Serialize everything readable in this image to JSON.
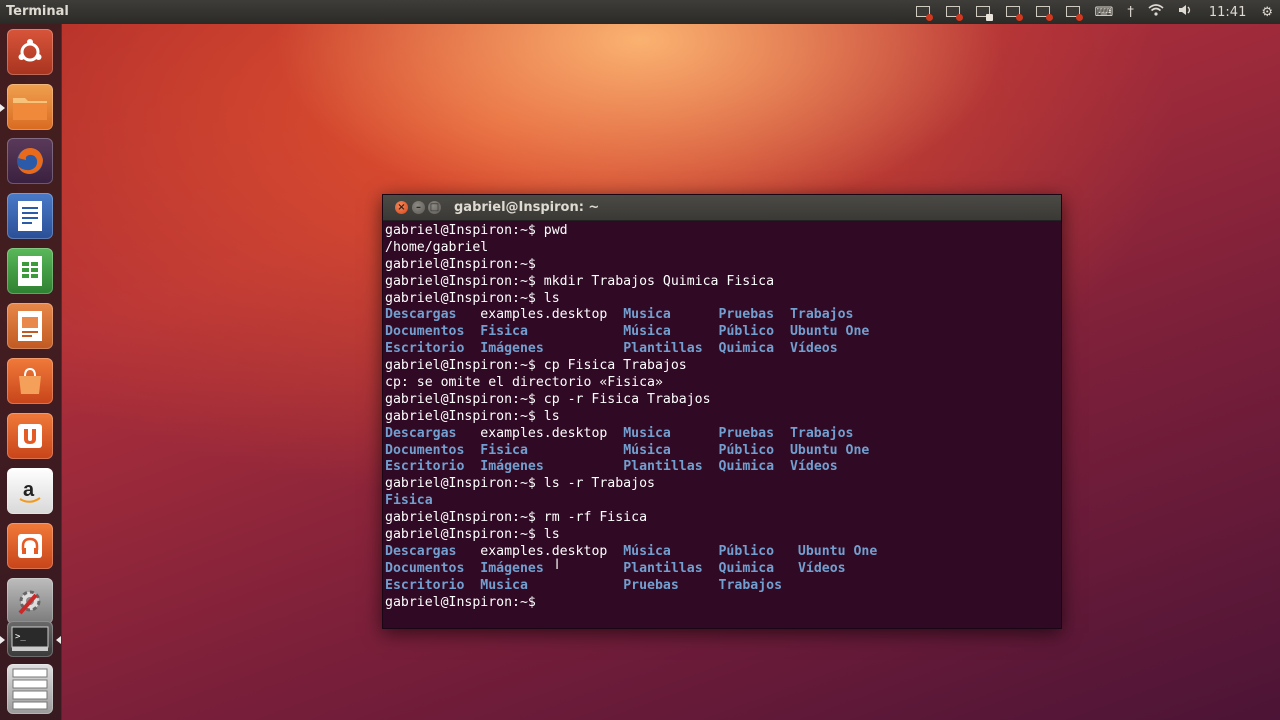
{
  "panel": {
    "app_title": "Terminal",
    "clock": "11:41",
    "indicators": [
      "bluetooth-icon",
      "wifi-icon",
      "volume-icon",
      "settings-gear-icon"
    ]
  },
  "launcher": {
    "items": [
      {
        "name": "ubuntu-dash",
        "color": "#c14a24"
      },
      {
        "name": "files",
        "color": "#e8853a"
      },
      {
        "name": "firefox",
        "color": "#e26a1f"
      },
      {
        "name": "libreoffice-writer",
        "color": "#2f6ab4"
      },
      {
        "name": "libreoffice-calc",
        "color": "#3c9a3a"
      },
      {
        "name": "libreoffice-impress",
        "color": "#d0682a"
      },
      {
        "name": "ubuntu-software-center",
        "color": "#e0582a"
      },
      {
        "name": "ubuntu-one",
        "color": "#e55b26"
      },
      {
        "name": "amazon",
        "color": "#eaeaea"
      },
      {
        "name": "ubuntu-one-music",
        "color": "#e55b26"
      },
      {
        "name": "system-settings",
        "color": "#9b9b9b"
      },
      {
        "name": "terminal",
        "color": "#3b3b3b"
      },
      {
        "name": "workspaces",
        "color": "#d8d8d8"
      }
    ]
  },
  "window": {
    "title": "gabriel@Inspiron: ~"
  },
  "terminal": {
    "lines": [
      [
        {
          "t": "gabriel@Inspiron:~$ pwd"
        }
      ],
      [
        {
          "t": "/home/gabriel"
        }
      ],
      [
        {
          "t": "gabriel@Inspiron:~$"
        }
      ],
      [
        {
          "t": "gabriel@Inspiron:~$ mkdir Trabajos Quimica Fisica"
        }
      ],
      [
        {
          "t": "gabriel@Inspiron:~$ ls"
        }
      ],
      [
        {
          "t": "Descargas",
          "d": 1
        },
        {
          "t": "   examples.desktop  "
        },
        {
          "t": "Musica",
          "d": 1
        },
        {
          "t": "      "
        },
        {
          "t": "Pruebas",
          "d": 1
        },
        {
          "t": "  "
        },
        {
          "t": "Trabajos",
          "d": 1
        }
      ],
      [
        {
          "t": "Documentos",
          "d": 1
        },
        {
          "t": "  "
        },
        {
          "t": "Fisica",
          "d": 1
        },
        {
          "t": "            "
        },
        {
          "t": "Música",
          "d": 1
        },
        {
          "t": "      "
        },
        {
          "t": "Público",
          "d": 1
        },
        {
          "t": "  "
        },
        {
          "t": "Ubuntu One",
          "d": 1
        }
      ],
      [
        {
          "t": "Escritorio",
          "d": 1
        },
        {
          "t": "  "
        },
        {
          "t": "Imágenes",
          "d": 1
        },
        {
          "t": "          "
        },
        {
          "t": "Plantillas",
          "d": 1
        },
        {
          "t": "  "
        },
        {
          "t": "Quimica",
          "d": 1
        },
        {
          "t": "  "
        },
        {
          "t": "Vídeos",
          "d": 1
        }
      ],
      [
        {
          "t": "gabriel@Inspiron:~$ cp Fisica Trabajos"
        }
      ],
      [
        {
          "t": "cp: se omite el directorio «Fisica»"
        }
      ],
      [
        {
          "t": "gabriel@Inspiron:~$ cp -r Fisica Trabajos"
        }
      ],
      [
        {
          "t": "gabriel@Inspiron:~$ ls"
        }
      ],
      [
        {
          "t": "Descargas",
          "d": 1
        },
        {
          "t": "   examples.desktop  "
        },
        {
          "t": "Musica",
          "d": 1
        },
        {
          "t": "      "
        },
        {
          "t": "Pruebas",
          "d": 1
        },
        {
          "t": "  "
        },
        {
          "t": "Trabajos",
          "d": 1
        }
      ],
      [
        {
          "t": "Documentos",
          "d": 1
        },
        {
          "t": "  "
        },
        {
          "t": "Fisica",
          "d": 1
        },
        {
          "t": "            "
        },
        {
          "t": "Música",
          "d": 1
        },
        {
          "t": "      "
        },
        {
          "t": "Público",
          "d": 1
        },
        {
          "t": "  "
        },
        {
          "t": "Ubuntu One",
          "d": 1
        }
      ],
      [
        {
          "t": "Escritorio",
          "d": 1
        },
        {
          "t": "  "
        },
        {
          "t": "Imágenes",
          "d": 1
        },
        {
          "t": "          "
        },
        {
          "t": "Plantillas",
          "d": 1
        },
        {
          "t": "  "
        },
        {
          "t": "Quimica",
          "d": 1
        },
        {
          "t": "  "
        },
        {
          "t": "Vídeos",
          "d": 1
        }
      ],
      [
        {
          "t": "gabriel@Inspiron:~$ ls -r Trabajos"
        }
      ],
      [
        {
          "t": "Fisica",
          "d": 1
        }
      ],
      [
        {
          "t": "gabriel@Inspiron:~$ rm -rf Fisica"
        }
      ],
      [
        {
          "t": "gabriel@Inspiron:~$ ls"
        }
      ],
      [
        {
          "t": "Descargas",
          "d": 1
        },
        {
          "t": "   examples.desktop  "
        },
        {
          "t": "Música",
          "d": 1
        },
        {
          "t": "      "
        },
        {
          "t": "Público",
          "d": 1
        },
        {
          "t": "   "
        },
        {
          "t": "Ubuntu One",
          "d": 1
        }
      ],
      [
        {
          "t": "Documentos",
          "d": 1
        },
        {
          "t": "  "
        },
        {
          "t": "Imágenes",
          "d": 1
        },
        {
          "t": "          "
        },
        {
          "t": "Plantillas",
          "d": 1
        },
        {
          "t": "  "
        },
        {
          "t": "Quimica",
          "d": 1
        },
        {
          "t": "   "
        },
        {
          "t": "Vídeos",
          "d": 1
        }
      ],
      [
        {
          "t": "Escritorio",
          "d": 1
        },
        {
          "t": "  "
        },
        {
          "t": "Musica",
          "d": 1
        },
        {
          "t": "            "
        },
        {
          "t": "Pruebas",
          "d": 1
        },
        {
          "t": "     "
        },
        {
          "t": "Trabajos",
          "d": 1
        }
      ],
      [
        {
          "t": "gabriel@Inspiron:~$ "
        }
      ]
    ]
  }
}
